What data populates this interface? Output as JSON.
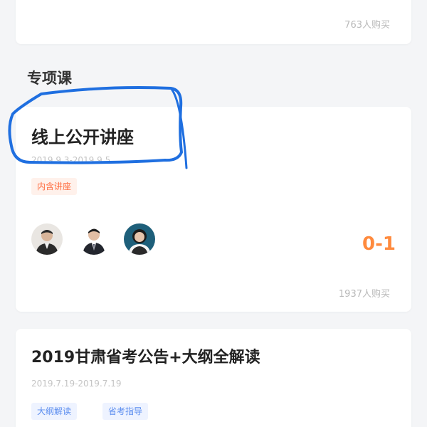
{
  "top_card": {
    "buyers": "763人购买"
  },
  "section": {
    "title": "专项课"
  },
  "course_public": {
    "title": "线上公开讲座",
    "date": "2019.9.3-2019.9.5",
    "tag": "内含讲座",
    "price": "0-1",
    "buyers": "1937人购买",
    "teachers": [
      {
        "name_icon": "teacher-avatar-1"
      },
      {
        "name_icon": "teacher-avatar-2"
      },
      {
        "name_icon": "teacher-avatar-3"
      }
    ]
  },
  "course_exam": {
    "title": "2019甘肃省考公告+大纲全解读",
    "date": "2019.7.19-2019.7.19",
    "tags": [
      "大纲解读",
      "省考指导"
    ]
  },
  "colors": {
    "accent_orange": "#ff8a3d",
    "tag_orange": "#ff6a3d",
    "tag_blue": "#5b8def",
    "annotation_blue": "#1f6fe0"
  }
}
